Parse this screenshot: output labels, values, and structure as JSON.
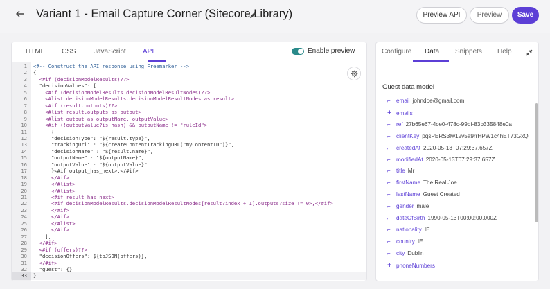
{
  "header": {
    "title": "Variant 1 - Email Capture Corner (Sitecore Library)",
    "buttons": {
      "preview_api": "Preview API",
      "preview": "Preview",
      "save": "Save"
    }
  },
  "left_panel": {
    "tabs": [
      "HTML",
      "CSS",
      "JavaScript",
      "API"
    ],
    "active_tab": "API",
    "toggle": {
      "label": "Enable preview",
      "on": true
    },
    "code_lines": [
      "<#-- Construct the API response using Freemarker -->",
      "{",
      "  <#if (decisionModelResults)??>",
      "  \"decisionValues\": [",
      "    <#if (decisionModelResults.decisionModelResultNodes)??>",
      "    <#list decisionModelResults.decisionModelResultNodes as result>",
      "    <#if (result.outputs)??>",
      "    <#list result.outputs as output>",
      "    <#list output as outputName, outputValue>",
      "    <#if (!outputValue?is_hash) && outputName != \"ruleId\">",
      "      {",
      "      \"decisionType\": \"${result.type}\",",
      "      \"trackingUrl\" : \"${createContentTrackingURL(\"myContentID\")}\",",
      "      \"decisionName\" : \"${result.name}\",",
      "      \"outputName\" : \"${outputName}\",",
      "      \"outputValue\" : \"${outputValue}\"",
      "      }<#if output_has_next>,</#if>",
      "      </#if>",
      "      </#list>",
      "      </#list>",
      "      <#if result_has_next>",
      "      <#if decisionModelResults.decisionModelResultNodes[result?index + 1].outputs?size != 0>,</#if>",
      "      </#if>",
      "      </#if>",
      "      </#list>",
      "      </#if>",
      "    ],",
      "  </#if>",
      "  <#if (offers)??>",
      "  \"decisionOffers\": ${toJSON(offers)},",
      "  </#if>",
      "  \"guest\": {}",
      "}"
    ],
    "current_line": 33
  },
  "right_panel": {
    "tabs": [
      "Configure",
      "Data",
      "Snippets",
      "Help"
    ],
    "active_tab": "Data",
    "section_title": "Guest data model",
    "properties": [
      {
        "icon": "link-icon",
        "key": "email",
        "value": "johndoe@gmail.com"
      },
      {
        "icon": "plus-icon",
        "key": "emails",
        "value": ""
      },
      {
        "icon": "link-icon",
        "key": "ref",
        "value": "27b65e67-4ce0-478c-99bf-83b335848e0a"
      },
      {
        "icon": "link-icon",
        "key": "clientKey",
        "value": "pqsPERS3lw12v5a9rrHPW1c4hET73GxQ"
      },
      {
        "icon": "link-icon",
        "key": "createdAt",
        "value": "2020-05-13T07:29:37.657Z"
      },
      {
        "icon": "link-icon",
        "key": "modifiedAt",
        "value": "2020-05-13T07:29:37.657Z"
      },
      {
        "icon": "link-icon",
        "key": "title",
        "value": "Mr"
      },
      {
        "icon": "link-icon",
        "key": "firstName",
        "value": "The Real Joe"
      },
      {
        "icon": "link-icon",
        "key": "lastName",
        "value": "Guest Created"
      },
      {
        "icon": "link-icon",
        "key": "gender",
        "value": "male"
      },
      {
        "icon": "link-icon",
        "key": "dateOfBirth",
        "value": "1990-05-13T00:00:00.000Z"
      },
      {
        "icon": "link-icon",
        "key": "nationality",
        "value": "IE"
      },
      {
        "icon": "link-icon",
        "key": "country",
        "value": "IE"
      },
      {
        "icon": "link-icon",
        "key": "city",
        "value": "Dublin"
      },
      {
        "icon": "plus-icon",
        "key": "phoneNumbers",
        "value": ""
      }
    ]
  },
  "colors": {
    "accent": "#5c3fd6",
    "toggle": "#2a8a8a",
    "code_tag": "#8a2d8a",
    "code_string": "#2c5d96",
    "code_default": "#333333"
  }
}
